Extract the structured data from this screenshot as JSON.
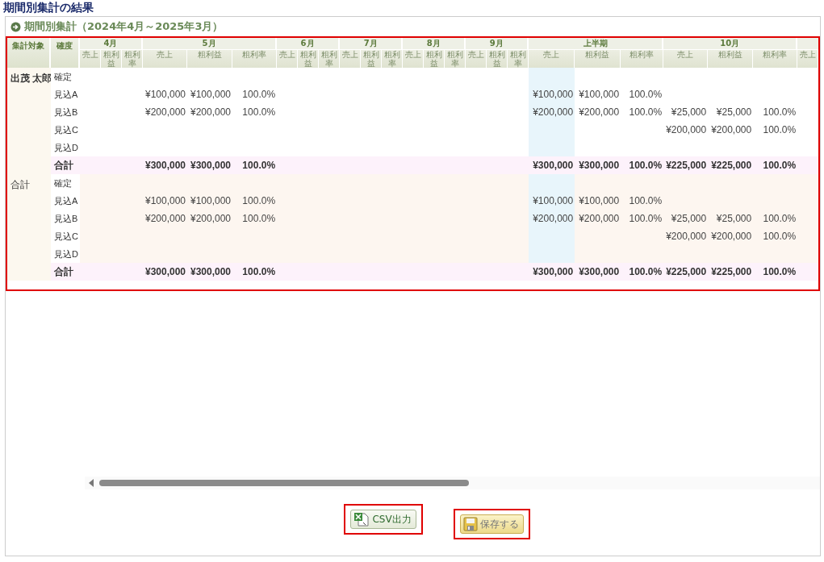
{
  "page_title": "期間別集計の結果",
  "panel": {
    "title": "期間別集計（2024年4月～2025年3月）",
    "table": {
      "highlighted": true,
      "corner_headers": [
        "集計対象",
        "確度"
      ],
      "column_groups": [
        {
          "label": "4月",
          "kind": "narrow",
          "subcolumns": [
            "売上",
            "粗利益",
            "粗利率"
          ]
        },
        {
          "label": "5月",
          "kind": "wide",
          "subcolumns": [
            "売上",
            "粗利益",
            "粗利率"
          ]
        },
        {
          "label": "6月",
          "kind": "narrow",
          "subcolumns": [
            "売上",
            "粗利益",
            "粗利率"
          ]
        },
        {
          "label": "7月",
          "kind": "narrow",
          "subcolumns": [
            "売上",
            "粗利益",
            "粗利率"
          ]
        },
        {
          "label": "8月",
          "kind": "narrow",
          "subcolumns": [
            "売上",
            "粗利益",
            "粗利率"
          ]
        },
        {
          "label": "9月",
          "kind": "narrow",
          "subcolumns": [
            "売上",
            "粗利益",
            "粗利率"
          ]
        },
        {
          "label": "上半期",
          "kind": "half",
          "subcolumns": [
            "売上",
            "粗利益",
            "粗利率"
          ]
        },
        {
          "label": "10月",
          "kind": "wide",
          "subcolumns": [
            "売上",
            "粗利益",
            "粗利率"
          ]
        },
        {
          "kind": "cut",
          "subcolumns": [
            "売上"
          ]
        }
      ],
      "sections": [
        {
          "target": "出茂 太郎",
          "kind": "person",
          "rows": [
            {
              "label": "確定",
              "kind": "detail",
              "groups": [
                {
                  "kind": "blank"
                },
                {
                  "kind": "blank"
                },
                {
                  "kind": "blank"
                },
                {
                  "kind": "blank"
                },
                {
                  "kind": "blank"
                },
                {
                  "kind": "blank"
                },
                {
                  "kind": "blank"
                },
                {
                  "kind": "blank"
                }
              ]
            },
            {
              "label": "見込A",
              "kind": "detail",
              "groups": [
                {
                  "kind": "blank"
                },
                {
                  "kind": "values",
                  "cells": [
                    "¥100,000",
                    "¥100,000",
                    "100.0%"
                  ]
                },
                {
                  "kind": "blank"
                },
                {
                  "kind": "blank"
                },
                {
                  "kind": "blank"
                },
                {
                  "kind": "blank"
                },
                {
                  "kind": "values",
                  "cells": [
                    "¥100,000",
                    "¥100,000",
                    "100.0%"
                  ]
                },
                {
                  "kind": "blank"
                }
              ]
            },
            {
              "label": "見込B",
              "kind": "detail",
              "groups": [
                {
                  "kind": "blank"
                },
                {
                  "kind": "values",
                  "cells": [
                    "¥200,000",
                    "¥200,000",
                    "100.0%"
                  ]
                },
                {
                  "kind": "blank"
                },
                {
                  "kind": "blank"
                },
                {
                  "kind": "blank"
                },
                {
                  "kind": "blank"
                },
                {
                  "kind": "values",
                  "cells": [
                    "¥200,000",
                    "¥200,000",
                    "100.0%"
                  ]
                },
                {
                  "kind": "values",
                  "cells": [
                    "¥25,000",
                    "¥25,000",
                    "100.0%"
                  ]
                }
              ]
            },
            {
              "label": "見込C",
              "kind": "detail",
              "groups": [
                {
                  "kind": "blank"
                },
                {
                  "kind": "blank"
                },
                {
                  "kind": "blank"
                },
                {
                  "kind": "blank"
                },
                {
                  "kind": "blank"
                },
                {
                  "kind": "blank"
                },
                {
                  "kind": "blank"
                },
                {
                  "kind": "values",
                  "cells": [
                    "¥200,000",
                    "¥200,000",
                    "100.0%"
                  ]
                }
              ]
            },
            {
              "label": "見込D",
              "kind": "detail",
              "groups": [
                {
                  "kind": "blank"
                },
                {
                  "kind": "blank"
                },
                {
                  "kind": "blank"
                },
                {
                  "kind": "blank"
                },
                {
                  "kind": "blank"
                },
                {
                  "kind": "blank"
                },
                {
                  "kind": "blank"
                },
                {
                  "kind": "blank"
                }
              ]
            },
            {
              "label": "合計",
              "kind": "total",
              "groups": [
                {
                  "kind": "blank"
                },
                {
                  "kind": "values",
                  "cells": [
                    "¥300,000",
                    "¥300,000",
                    "100.0%"
                  ]
                },
                {
                  "kind": "blank"
                },
                {
                  "kind": "blank"
                },
                {
                  "kind": "blank"
                },
                {
                  "kind": "blank"
                },
                {
                  "kind": "values",
                  "cells": [
                    "¥300,000",
                    "¥300,000",
                    "100.0%"
                  ]
                },
                {
                  "kind": "values",
                  "cells": [
                    "¥225,000",
                    "¥225,000",
                    "100.0%"
                  ]
                }
              ]
            }
          ]
        },
        {
          "target": "合計",
          "kind": "total",
          "rows": [
            {
              "label": "確定",
              "kind": "detail",
              "groups": [
                {
                  "kind": "blank"
                },
                {
                  "kind": "blank"
                },
                {
                  "kind": "blank"
                },
                {
                  "kind": "blank"
                },
                {
                  "kind": "blank"
                },
                {
                  "kind": "blank"
                },
                {
                  "kind": "blank"
                },
                {
                  "kind": "blank"
                }
              ]
            },
            {
              "label": "見込A",
              "kind": "detail",
              "groups": [
                {
                  "kind": "blank"
                },
                {
                  "kind": "values",
                  "cells": [
                    "¥100,000",
                    "¥100,000",
                    "100.0%"
                  ]
                },
                {
                  "kind": "blank"
                },
                {
                  "kind": "blank"
                },
                {
                  "kind": "blank"
                },
                {
                  "kind": "blank"
                },
                {
                  "kind": "values",
                  "cells": [
                    "¥100,000",
                    "¥100,000",
                    "100.0%"
                  ]
                },
                {
                  "kind": "blank"
                }
              ]
            },
            {
              "label": "見込B",
              "kind": "detail",
              "groups": [
                {
                  "kind": "blank"
                },
                {
                  "kind": "values",
                  "cells": [
                    "¥200,000",
                    "¥200,000",
                    "100.0%"
                  ]
                },
                {
                  "kind": "blank"
                },
                {
                  "kind": "blank"
                },
                {
                  "kind": "blank"
                },
                {
                  "kind": "blank"
                },
                {
                  "kind": "values",
                  "cells": [
                    "¥200,000",
                    "¥200,000",
                    "100.0%"
                  ]
                },
                {
                  "kind": "values",
                  "cells": [
                    "¥25,000",
                    "¥25,000",
                    "100.0%"
                  ]
                }
              ]
            },
            {
              "label": "見込C",
              "kind": "detail",
              "groups": [
                {
                  "kind": "blank"
                },
                {
                  "kind": "blank"
                },
                {
                  "kind": "blank"
                },
                {
                  "kind": "blank"
                },
                {
                  "kind": "blank"
                },
                {
                  "kind": "blank"
                },
                {
                  "kind": "blank"
                },
                {
                  "kind": "values",
                  "cells": [
                    "¥200,000",
                    "¥200,000",
                    "100.0%"
                  ]
                }
              ]
            },
            {
              "label": "見込D",
              "kind": "detail",
              "groups": [
                {
                  "kind": "blank"
                },
                {
                  "kind": "blank"
                },
                {
                  "kind": "blank"
                },
                {
                  "kind": "blank"
                },
                {
                  "kind": "blank"
                },
                {
                  "kind": "blank"
                },
                {
                  "kind": "blank"
                },
                {
                  "kind": "blank"
                }
              ]
            },
            {
              "label": "合計",
              "kind": "total",
              "groups": [
                {
                  "kind": "blank"
                },
                {
                  "kind": "values",
                  "cells": [
                    "¥300,000",
                    "¥300,000",
                    "100.0%"
                  ]
                },
                {
                  "kind": "blank"
                },
                {
                  "kind": "blank"
                },
                {
                  "kind": "blank"
                },
                {
                  "kind": "blank"
                },
                {
                  "kind": "values",
                  "cells": [
                    "¥300,000",
                    "¥300,000",
                    "100.0%"
                  ]
                },
                {
                  "kind": "values",
                  "cells": [
                    "¥225,000",
                    "¥225,000",
                    "100.0%"
                  ]
                }
              ]
            }
          ]
        }
      ]
    }
  },
  "buttons": [
    {
      "label": "CSV出力",
      "kind": "csv",
      "highlighted": true
    },
    {
      "label": "保存する",
      "kind": "save",
      "highlighted": true
    }
  ]
}
